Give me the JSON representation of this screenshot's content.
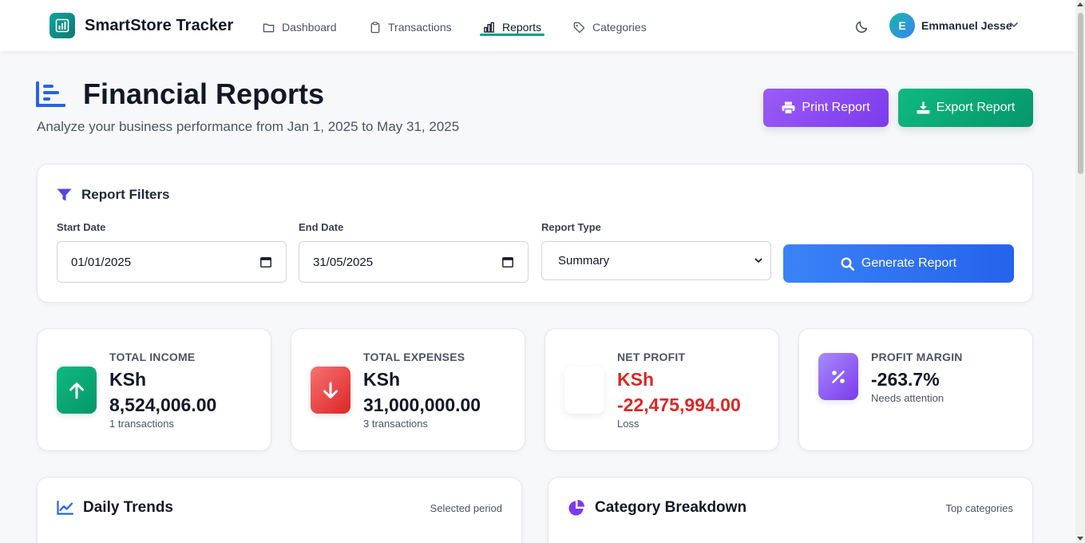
{
  "app": {
    "name": "SmartStore Tracker"
  },
  "nav": {
    "items": [
      {
        "label": "Dashboard",
        "icon": "folder-icon"
      },
      {
        "label": "Transactions",
        "icon": "clipboard-icon"
      },
      {
        "label": "Reports",
        "icon": "bar-chart-icon",
        "active": true
      },
      {
        "label": "Categories",
        "icon": "tag-icon"
      }
    ],
    "accent_color": "#0f9f85"
  },
  "user": {
    "initial": "E",
    "name": "Emmanuel Jesse"
  },
  "header": {
    "title": "Financial Reports",
    "subtitle": "Analyze your business performance from Jan 1, 2025 to May 31, 2025",
    "print_label": "Print Report",
    "export_label": "Export Report"
  },
  "filters": {
    "title": "Report Filters",
    "start_label": "Start Date",
    "start_value": "01/01/2025",
    "end_label": "End Date",
    "end_value": "31/05/2025",
    "type_label": "Report Type",
    "type_value": "Summary",
    "generate_label": "Generate Report"
  },
  "stats": {
    "income": {
      "label": "TOTAL INCOME",
      "value_currency": "KSh",
      "value_amount": "8,524,006.00",
      "sub": "1 transactions",
      "color": "#10b981"
    },
    "expenses": {
      "label": "TOTAL EXPENSES",
      "value_currency": "KSh",
      "value_amount": "31,000,000.00",
      "sub": "3 transactions",
      "color": "#ef4444"
    },
    "profit": {
      "label": "NET PROFIT",
      "value_currency": "KSh",
      "value_amount": "-22,475,994.00",
      "sub": "Loss",
      "color": "#dc2626"
    },
    "margin": {
      "label": "PROFIT MARGIN",
      "value": "-263.7%",
      "sub": "Needs attention",
      "color": "#8b5cf6"
    }
  },
  "sections": {
    "daily": {
      "title": "Daily Trends",
      "note": "Selected period"
    },
    "category": {
      "title": "Category Breakdown",
      "note": "Top categories"
    }
  }
}
